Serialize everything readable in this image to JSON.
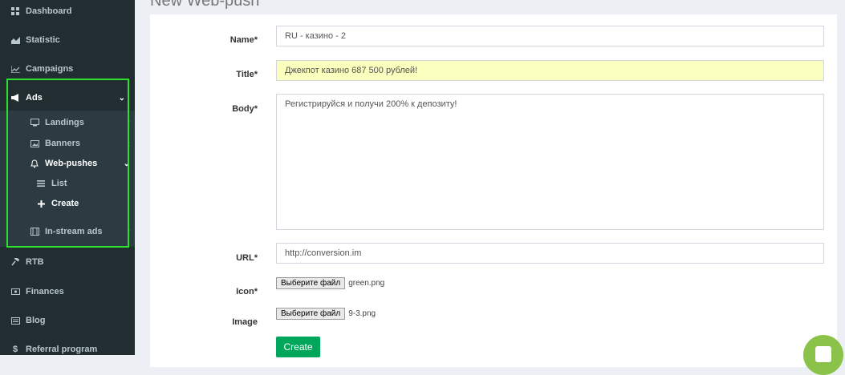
{
  "page_title": "New Web-push",
  "sidebar": {
    "items": [
      {
        "label": "Dashboard",
        "icon": "grid-icon"
      },
      {
        "label": "Statistic",
        "icon": "area-chart-icon"
      },
      {
        "label": "Campaigns",
        "icon": "line-chart-icon"
      },
      {
        "label": "Ads",
        "icon": "megaphone-icon"
      },
      {
        "label": "Landings",
        "icon": "monitor-icon"
      },
      {
        "label": "Banners",
        "icon": "image-icon"
      },
      {
        "label": "Web-pushes",
        "icon": "bell-icon"
      },
      {
        "label": "List",
        "icon": "list-icon"
      },
      {
        "label": "Create",
        "icon": "plus-icon"
      },
      {
        "label": "In-stream ads",
        "icon": "film-icon"
      },
      {
        "label": "RTB",
        "icon": "gavel-icon"
      },
      {
        "label": "Finances",
        "icon": "money-icon"
      },
      {
        "label": "Blog",
        "icon": "newspaper-icon"
      },
      {
        "label": "Referral program",
        "icon": "dollar-icon"
      }
    ]
  },
  "form": {
    "name_label": "Name*",
    "name_value": "RU - казино - 2",
    "title_label": "Title*",
    "title_value": "Джекпот казино 687 500 рублей!",
    "body_label": "Body*",
    "body_value": "Регистрируйся и получи 200% к депозиту!",
    "url_label": "URL*",
    "url_value": "http://conversion.im",
    "icon_label": "Icon*",
    "icon_button": "Выберите файл",
    "icon_file": "green.png",
    "image_label": "Image",
    "image_button": "Выберите файл",
    "image_file": "9-3.png",
    "create_button": "Create"
  },
  "colors": {
    "sidebar_bg": "#222d32",
    "highlight_box": "#2ee02e",
    "create_button": "#00a65a",
    "title_field_bg": "#faffbd",
    "chat_widget": "#8bc34a"
  }
}
